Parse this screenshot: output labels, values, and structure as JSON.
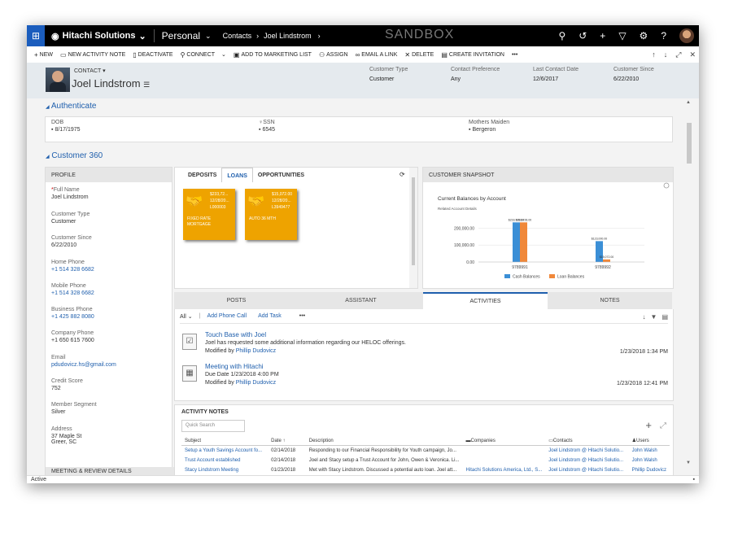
{
  "topbar": {
    "brand": "Hitachi Solutions",
    "area": "Personal",
    "breadcrumb_1": "Contacts",
    "breadcrumb_2": "Joel Lindstrom",
    "environment": "SANDBOX"
  },
  "commands": [
    {
      "icon": "+",
      "label": "NEW"
    },
    {
      "icon": "▭",
      "label": "NEW ACTIVITY NOTE"
    },
    {
      "icon": "▯",
      "label": "DEACTIVATE"
    },
    {
      "icon": "⚲",
      "label": "CONNECT"
    },
    {
      "icon": "▣",
      "label": "ADD TO MARKETING LIST"
    },
    {
      "icon": "⚇",
      "label": "ASSIGN"
    },
    {
      "icon": "∞",
      "label": "EMAIL A LINK"
    },
    {
      "icon": "✕",
      "label": "DELETE"
    },
    {
      "icon": "▤",
      "label": "CREATE INVITATION"
    },
    {
      "icon": "",
      "label": "•••"
    }
  ],
  "header": {
    "entity": "CONTACT ▾",
    "name": "Joel Lindstrom",
    "fields": [
      {
        "label": "Customer Type",
        "value": "Customer"
      },
      {
        "label": "Contact Preference",
        "value": "Any"
      },
      {
        "label": "Last Contact Date",
        "value": "12/6/2017"
      },
      {
        "label": "Customer Since",
        "value": "6/22/2010"
      }
    ]
  },
  "authenticate": {
    "title": "Authenticate",
    "dob_label": "DOB",
    "dob": "8/17/1975",
    "ssn_label": "SSN",
    "ssn": "6545",
    "maiden_label": "Mothers Maiden",
    "maiden": "Bergeron"
  },
  "customer360": {
    "title": "Customer 360"
  },
  "profile": {
    "header": "PROFILE",
    "fields": [
      {
        "label": "Full Name",
        "value": "Joel Lindstrom"
      },
      {
        "label": "Customer Type",
        "value": "Customer"
      },
      {
        "label": "Customer Since",
        "value": "6/22/2010"
      },
      {
        "label": "Home Phone",
        "value": "+1 514 328 6682"
      },
      {
        "label": "Mobile Phone",
        "value": "+1 514 328 6682"
      },
      {
        "label": "Business Phone",
        "value": "+1 425 882 8080"
      },
      {
        "label": "Company Phone",
        "value": "+1 650 615 7600"
      },
      {
        "label": "Email",
        "value": "pdudovicz.hs@gmail.com"
      },
      {
        "label": "Credit Score",
        "value": "752"
      },
      {
        "label": "Member Segment",
        "value": "Silver"
      },
      {
        "label": "Address",
        "value": "37 Maple St",
        "value2": "Greer, SC"
      }
    ],
    "footer": "MEETING & REVIEW DETAILS"
  },
  "loans": {
    "tabs": [
      "DEPOSITS",
      "LOANS",
      "OPPORTUNITIES"
    ],
    "tiles": [
      {
        "amount": "$233,72...",
        "date": "12/28/20...",
        "id": "L000003",
        "desc1": "FIXED RATE",
        "desc2": "MORTGAGE"
      },
      {
        "amount": "$15,072.00",
        "date": "12/28/20...",
        "id": "L3949477",
        "desc1": "AUTO 36 MTH",
        "desc2": ""
      }
    ]
  },
  "snapshot": {
    "header": "CUSTOMER SNAPSHOT",
    "chart_title": "Current Balances by Account",
    "chart_subtitle": "Related Account Details"
  },
  "chart_data": {
    "type": "bar",
    "categories": [
      "9789991",
      "9789992"
    ],
    "series": [
      {
        "name": "Cash Balances",
        "color": "#3b8fd6",
        "values": [
          233728,
          123000
        ]
      },
      {
        "name": "Loan Balances",
        "color": "#f0883a",
        "values": [
          233728,
          15072
        ]
      }
    ],
    "data_labels": [
      [
        "$233,728.00",
        "$233,728.00"
      ],
      [
        "$123,000.00",
        "$15,072.00"
      ]
    ],
    "yticks": [
      "200,000.00",
      "100,000.00",
      "0.00"
    ],
    "ylim": [
      0,
      240000
    ]
  },
  "midtabs": [
    "POSTS",
    "ASSISTANT",
    "ACTIVITIES",
    "NOTES"
  ],
  "activities": {
    "filter": "All",
    "add_call": "Add Phone Call",
    "add_task": "Add Task",
    "more": "•••",
    "items": [
      {
        "title": "Touch Base with Joel",
        "line1": "Joel has requested some additional information regarding our HELOC offerings.",
        "modified_label": "Modified by",
        "modified_by": "Phillip Dudovicz",
        "date": "1/23/2018 1:34 PM"
      },
      {
        "title": "Meeting with Hitachi",
        "line1_label": "Due Date",
        "line1": "1/23/2018 4:00 PM",
        "modified_label": "Modified by",
        "modified_by": "Phillip Dudovicz",
        "date": "1/23/2018 12:41 PM"
      }
    ]
  },
  "notes": {
    "title": "ACTIVITY NOTES",
    "search_placeholder": "Quick Search",
    "columns": [
      "Subject",
      "Date ↑",
      "Description",
      "Companies",
      "Contacts",
      "Users"
    ],
    "rows": [
      [
        "Setup a Youth Savings Account fo...",
        "02/14/2018",
        "Responding to our Financial Responsibility for Youth campaign, Jo...",
        "",
        "Joel Lindstrom @ Hitachi Solutio...",
        "John Walsh"
      ],
      [
        "Trust Account established",
        "02/14/2018",
        "Joel and Stacy setup a Trust Account for John, Owen & Veronica. Li...",
        "",
        "Joel Lindstrom @ Hitachi Solutio...",
        "John Walsh"
      ],
      [
        "Stacy Lindstrom Meeting",
        "01/23/2018",
        "Met with Stacy Lindstrom. Discussed a potential auto loan. Joel att...",
        "Hitachi Solutions America, Ltd., S...",
        "Joel Lindstrom @ Hitachi Solutio...",
        "Phillip Dudovicz"
      ]
    ]
  },
  "status": {
    "text": "Active"
  }
}
